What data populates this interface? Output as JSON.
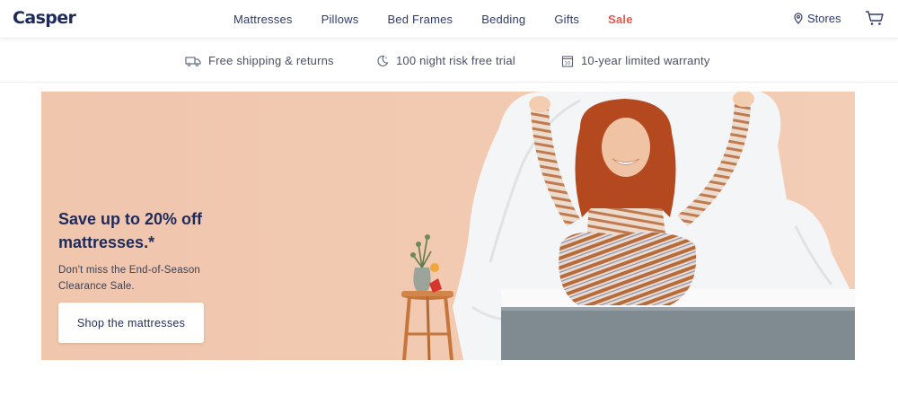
{
  "header": {
    "logo": "Casper",
    "nav": [
      "Mattresses",
      "Pillows",
      "Bed Frames",
      "Bedding",
      "Gifts",
      "Sale"
    ],
    "stores_label": "Stores",
    "cart_icon": "cart-icon",
    "stores_icon": "map-pin-icon"
  },
  "value_props": [
    {
      "icon": "truck-icon",
      "label": "Free shipping & returns"
    },
    {
      "icon": "moon-icon",
      "label": "100 night risk free trial"
    },
    {
      "icon": "calendar-icon",
      "label": "10-year limited warranty"
    }
  ],
  "hero": {
    "title_line1": "Save up to 20% off",
    "title_line2": "mattresses.*",
    "subtitle_line1": "Don't miss the End-of-Season",
    "subtitle_line2": "Clearance Sale.",
    "cta_label": "Shop the mattresses"
  },
  "colors": {
    "brand": "#1f2a5c",
    "sale": "#e4574b",
    "hero_bg": "#f1c7ae"
  }
}
